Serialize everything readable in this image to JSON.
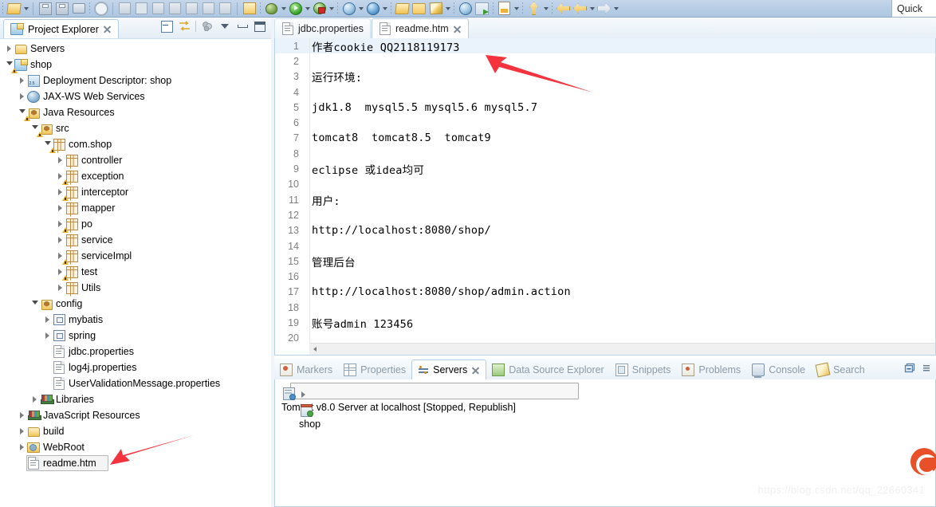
{
  "toolbar": {
    "quick_access_label": "Quick",
    "items": [
      {
        "name": "new-wizard-icon",
        "glyph": "folder-new"
      },
      {
        "name": "new-dropdown-arrow",
        "glyph": "arrow"
      },
      {
        "name": "save-icon",
        "glyph": "save"
      },
      {
        "name": "save-all-icon",
        "glyph": "save-all"
      },
      {
        "name": "print-icon",
        "glyph": "print"
      },
      {
        "name": "quick-search-icon",
        "glyph": "search"
      },
      {
        "name": "step-over-icon",
        "glyph": "gray"
      },
      {
        "name": "suspend-icon",
        "glyph": "gray"
      },
      {
        "name": "terminate-icon",
        "glyph": "gray"
      },
      {
        "name": "disconnect-icon",
        "glyph": "gray"
      },
      {
        "name": "step-into-icon",
        "glyph": "gray"
      },
      {
        "name": "step-return-icon",
        "glyph": "gray"
      },
      {
        "name": "step-out-icon",
        "glyph": "gray"
      },
      {
        "name": "open-type-icon",
        "glyph": "stack"
      },
      {
        "name": "debug-icon",
        "glyph": "bug"
      },
      {
        "name": "debug-dropdown-arrow",
        "glyph": "arrow"
      },
      {
        "name": "run-icon",
        "glyph": "run"
      },
      {
        "name": "run-dropdown-arrow",
        "glyph": "arrow"
      },
      {
        "name": "run-as-server-icon",
        "glyph": "run-red"
      },
      {
        "name": "run-server-dropdown-arrow",
        "glyph": "arrow"
      },
      {
        "name": "run-on-server-icon",
        "glyph": "globe"
      },
      {
        "name": "globe-dropdown-arrow",
        "glyph": "arrow"
      },
      {
        "name": "profile-icon",
        "glyph": "globe2"
      },
      {
        "name": "profile-dropdown-arrow",
        "glyph": "arrow"
      },
      {
        "name": "new-folder-icon",
        "glyph": "folder-open"
      },
      {
        "name": "open-folder-icon",
        "glyph": "folder"
      },
      {
        "name": "edit-icon",
        "glyph": "pencil"
      },
      {
        "name": "edit-dropdown-arrow",
        "glyph": "arrow"
      },
      {
        "name": "web-browser-icon",
        "glyph": "globe"
      },
      {
        "name": "open-perspective-icon",
        "glyph": "perspective"
      },
      {
        "name": "jsp-icon",
        "glyph": "jsp"
      },
      {
        "name": "jsp-dropdown-arrow",
        "glyph": "arrow"
      },
      {
        "name": "previous-annotation-icon",
        "glyph": "up-arrow"
      },
      {
        "name": "annotation-dropdown-arrow",
        "glyph": "arrow"
      },
      {
        "name": "back-icon",
        "glyph": "arrow-left"
      },
      {
        "name": "back-history-icon",
        "glyph": "arrow-left"
      },
      {
        "name": "back-dropdown-arrow",
        "glyph": "arrow"
      },
      {
        "name": "forward-icon",
        "glyph": "arrow-right"
      },
      {
        "name": "forward-dropdown-arrow",
        "glyph": "arrow"
      }
    ]
  },
  "project_explorer": {
    "title": "Project Explorer",
    "tools": [
      "collapse-all-icon",
      "link-with-editor-icon",
      "view-filter-icon",
      "view-menu-icon",
      "minimize-icon",
      "maximize-icon"
    ],
    "tree": [
      {
        "label": "Servers",
        "indent": 0,
        "twisty": "closed",
        "icon": "folder-open",
        "warn": false,
        "selected": false
      },
      {
        "label": "shop",
        "indent": 0,
        "twisty": "open",
        "icon": "project",
        "warn": true,
        "selected": false
      },
      {
        "label": "Deployment Descriptor: shop",
        "indent": 1,
        "twisty": "closed",
        "icon": "deployment-descriptor",
        "warn": false,
        "selected": false
      },
      {
        "label": "JAX-WS Web Services",
        "indent": 1,
        "twisty": "closed",
        "icon": "web-service",
        "warn": false,
        "selected": false
      },
      {
        "label": "Java Resources",
        "indent": 1,
        "twisty": "open",
        "icon": "package-root",
        "warn": true,
        "selected": false
      },
      {
        "label": "src",
        "indent": 2,
        "twisty": "open",
        "icon": "package-root",
        "warn": true,
        "selected": false
      },
      {
        "label": "com.shop",
        "indent": 3,
        "twisty": "open",
        "icon": "package",
        "warn": true,
        "selected": false
      },
      {
        "label": "controller",
        "indent": 4,
        "twisty": "closed",
        "icon": "package",
        "warn": false,
        "selected": false
      },
      {
        "label": "exception",
        "indent": 4,
        "twisty": "closed",
        "icon": "package",
        "warn": true,
        "selected": false
      },
      {
        "label": "interceptor",
        "indent": 4,
        "twisty": "closed",
        "icon": "package",
        "warn": true,
        "selected": false
      },
      {
        "label": "mapper",
        "indent": 4,
        "twisty": "closed",
        "icon": "package",
        "warn": false,
        "selected": false
      },
      {
        "label": "po",
        "indent": 4,
        "twisty": "closed",
        "icon": "package",
        "warn": true,
        "selected": false
      },
      {
        "label": "service",
        "indent": 4,
        "twisty": "closed",
        "icon": "package",
        "warn": false,
        "selected": false
      },
      {
        "label": "serviceImpl",
        "indent": 4,
        "twisty": "closed",
        "icon": "package",
        "warn": true,
        "selected": false
      },
      {
        "label": "test",
        "indent": 4,
        "twisty": "closed",
        "icon": "package",
        "warn": true,
        "selected": false
      },
      {
        "label": "Utils",
        "indent": 4,
        "twisty": "closed",
        "icon": "package",
        "warn": false,
        "selected": false
      },
      {
        "label": "config",
        "indent": 2,
        "twisty": "open",
        "icon": "package-root-open",
        "warn": false,
        "selected": false
      },
      {
        "label": "mybatis",
        "indent": 3,
        "twisty": "closed",
        "icon": "config",
        "warn": false,
        "selected": false
      },
      {
        "label": "spring",
        "indent": 3,
        "twisty": "closed",
        "icon": "config",
        "warn": false,
        "selected": false
      },
      {
        "label": "jdbc.properties",
        "indent": 3,
        "twisty": "none",
        "icon": "file",
        "warn": false,
        "selected": false
      },
      {
        "label": "log4j.properties",
        "indent": 3,
        "twisty": "none",
        "icon": "file",
        "warn": false,
        "selected": false
      },
      {
        "label": "UserValidationMessage.properties",
        "indent": 3,
        "twisty": "none",
        "icon": "file",
        "warn": false,
        "selected": false
      },
      {
        "label": "Libraries",
        "indent": 2,
        "twisty": "closed",
        "icon": "library",
        "warn": false,
        "selected": false
      },
      {
        "label": "JavaScript Resources",
        "indent": 1,
        "twisty": "closed",
        "icon": "library",
        "warn": false,
        "selected": false
      },
      {
        "label": "build",
        "indent": 1,
        "twisty": "closed",
        "icon": "folder-open",
        "warn": false,
        "selected": false
      },
      {
        "label": "WebRoot",
        "indent": 1,
        "twisty": "closed",
        "icon": "webroot",
        "warn": false,
        "selected": false
      },
      {
        "label": "readme.htm",
        "indent": 1,
        "twisty": "none",
        "icon": "file",
        "warn": false,
        "selected": true
      }
    ]
  },
  "editor": {
    "tabs": [
      {
        "label": "jdbc.properties",
        "active": false,
        "closable": false,
        "icon": "file-icon"
      },
      {
        "label": "readme.htm",
        "active": true,
        "closable": true,
        "icon": "file-icon"
      }
    ],
    "current_line": 1,
    "lines": [
      {
        "n": "1",
        "text": "作者cookie QQ2118119173"
      },
      {
        "n": "2",
        "text": ""
      },
      {
        "n": "3",
        "text": "运行环境:"
      },
      {
        "n": "4",
        "text": ""
      },
      {
        "n": "5",
        "text": "jdk1.8  mysql5.5 mysql5.6 mysql5.7"
      },
      {
        "n": "6",
        "text": ""
      },
      {
        "n": "7",
        "text": "tomcat8  tomcat8.5  tomcat9"
      },
      {
        "n": "8",
        "text": ""
      },
      {
        "n": "9",
        "text": "eclipse 或idea均可"
      },
      {
        "n": "10",
        "text": ""
      },
      {
        "n": "11",
        "text": "用户:"
      },
      {
        "n": "12",
        "text": ""
      },
      {
        "n": "13",
        "text": "http://localhost:8080/shop/"
      },
      {
        "n": "14",
        "text": ""
      },
      {
        "n": "15",
        "text": "管理后台"
      },
      {
        "n": "16",
        "text": ""
      },
      {
        "n": "17",
        "text": "http://localhost:8080/shop/admin.action"
      },
      {
        "n": "18",
        "text": ""
      },
      {
        "n": "19",
        "text": "账号admin 123456"
      },
      {
        "n": "20",
        "text": ""
      }
    ]
  },
  "bottom_panel": {
    "tabs": [
      {
        "label": "Markers",
        "active": false,
        "icon": "markers-icon",
        "closable": false
      },
      {
        "label": "Properties",
        "active": false,
        "icon": "properties-icon",
        "closable": false
      },
      {
        "label": "Servers",
        "active": true,
        "icon": "servers-icon",
        "closable": true
      },
      {
        "label": "Data Source Explorer",
        "active": false,
        "icon": "data-source-explorer-icon",
        "closable": false
      },
      {
        "label": "Snippets",
        "active": false,
        "icon": "snippets-icon",
        "closable": false
      },
      {
        "label": "Problems",
        "active": false,
        "icon": "problems-icon",
        "closable": false
      },
      {
        "label": "Console",
        "active": false,
        "icon": "console-icon",
        "closable": false
      },
      {
        "label": "Search",
        "active": false,
        "icon": "search-icon",
        "closable": false
      }
    ],
    "tools": [
      "minimize-icon",
      "maximize-icon"
    ],
    "rows": [
      {
        "label": "Tomcat v8.0 Server at localhost  [Stopped, Republish]",
        "indent": 0,
        "twisty": "open",
        "icon": "server",
        "selected": true
      },
      {
        "label": "shop",
        "indent": 1,
        "twisty": "closed",
        "icon": "module",
        "selected": false
      }
    ]
  },
  "annotations": {
    "arrow_color": "#f5333f",
    "watermark_text": "https://blog.csdn.net/qq_22860341",
    "watermark_color": "#f0f0f0",
    "logo_color": "#e8502a"
  }
}
